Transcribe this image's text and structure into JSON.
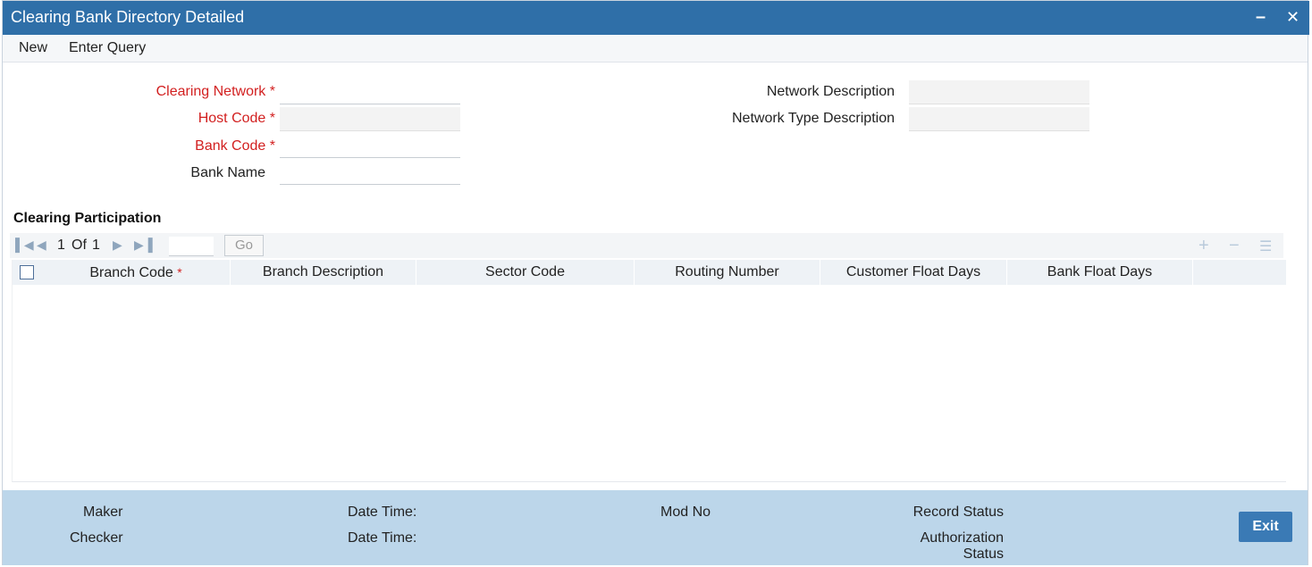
{
  "window": {
    "title": "Clearing Bank Directory Detailed",
    "minimize_glyph": "–",
    "close_glyph": "✕"
  },
  "menu": {
    "new_label": "New",
    "enter_query_label": "Enter Query"
  },
  "form": {
    "clearing_network_label": "Clearing Network",
    "host_code_label": "Host Code",
    "bank_code_label": "Bank Code",
    "bank_name_label": "Bank Name",
    "network_description_label": "Network Description",
    "network_type_description_label": "Network Type Description",
    "required_marker": "*",
    "clearing_network_value": "",
    "host_code_value": "",
    "bank_code_value": "",
    "bank_name_value": "",
    "network_description_value": "",
    "network_type_description_value": ""
  },
  "participation": {
    "section_title": "Clearing Participation",
    "pager": {
      "current": "1",
      "of_label": "Of",
      "total": "1",
      "go_label": "Go"
    },
    "columns": [
      "Branch Code",
      "Branch Description",
      "Sector Code",
      "Routing Number",
      "Customer Float Days",
      "Bank Float Days"
    ],
    "rows": []
  },
  "footer": {
    "maker_label": "Maker",
    "checker_label": "Checker",
    "date_time_label_1": "Date Time:",
    "date_time_label_2": "Date Time:",
    "mod_no_label": "Mod No",
    "record_status_label": "Record Status",
    "authorization_label_line1": "Authorization",
    "authorization_label_line2": "Status",
    "exit_label": "Exit"
  },
  "colors": {
    "titlebar": "#2f6fa8",
    "required": "#d21f1f",
    "footer": "#bcd6ea",
    "exit_button": "#3a7ab5"
  }
}
